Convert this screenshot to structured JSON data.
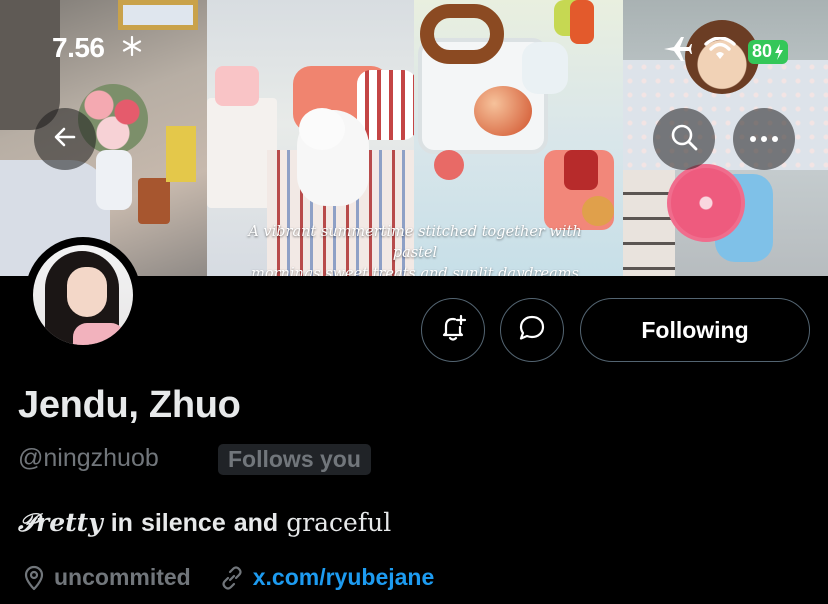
{
  "status_bar": {
    "time": "7.56",
    "weather_icon": "snowflake-icon",
    "battery": "80",
    "icons": [
      "airplane-icon",
      "wifi-icon",
      "battery-icon"
    ]
  },
  "banner": {
    "caption_line1": "A vibrant summertime stitched together with pastel",
    "caption_line2": "mornings sweet treats and sunlit daydreams"
  },
  "nav": {
    "back_icon": "arrow-left-icon",
    "search_icon": "search-icon",
    "more_icon": "more-horizontal-icon"
  },
  "actions": {
    "notify_icon": "bell-plus-icon",
    "message_icon": "message-bubble-icon",
    "following_label": "Following"
  },
  "profile": {
    "display_name": "Jendu, Zhuo",
    "handle": "@ningzhuob",
    "follows_you": "Follows you",
    "bio": {
      "part1": "𝒫retty",
      "part2": "in",
      "part3": "silence",
      "part4": "and",
      "part5": "graceful"
    },
    "location": "uncommited",
    "website": "x.com/ryubejane"
  },
  "colors": {
    "background": "#000000",
    "text_primary": "#e7e9ea",
    "text_secondary": "#71767b",
    "link": "#1d9bf0",
    "border": "#536471",
    "battery": "#34c759"
  }
}
